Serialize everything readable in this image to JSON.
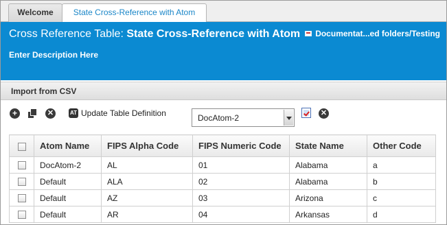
{
  "tabs": [
    {
      "label": "Welcome",
      "active": false
    },
    {
      "label": "State Cross-Reference with Atom",
      "active": true
    }
  ],
  "header": {
    "title_prefix": "Cross Reference Table:",
    "title_name": "State Cross-Reference with Atom",
    "path": "Documentat...ed folders/Testing",
    "description": "Enter Description Here",
    "background": "#0b8ad2"
  },
  "import_bar": {
    "label": "Import from CSV"
  },
  "toolbar": {
    "update_label": "Update Table Definition",
    "atom_select_value": "DocAtom-2",
    "icons": [
      "add-icon",
      "copy-icon",
      "delete-icon",
      "atom-icon",
      "checklist-icon",
      "clear-icon"
    ]
  },
  "grid": {
    "columns": [
      "Atom Name",
      "FIPS Alpha Code",
      "FIPS Numeric Code",
      "State Name",
      "Other Code"
    ],
    "rows": [
      {
        "atom": "DocAtom-2",
        "alpha": "AL",
        "numeric": "01",
        "state": "Alabama",
        "other": "a"
      },
      {
        "atom": "Default",
        "alpha": "ALA",
        "numeric": "02",
        "state": "Alabama",
        "other": "b"
      },
      {
        "atom": "Default",
        "alpha": "AZ",
        "numeric": "03",
        "state": "Arizona",
        "other": "c"
      },
      {
        "atom": "Default",
        "alpha": "AR",
        "numeric": "04",
        "state": "Arkansas",
        "other": "d"
      }
    ]
  }
}
